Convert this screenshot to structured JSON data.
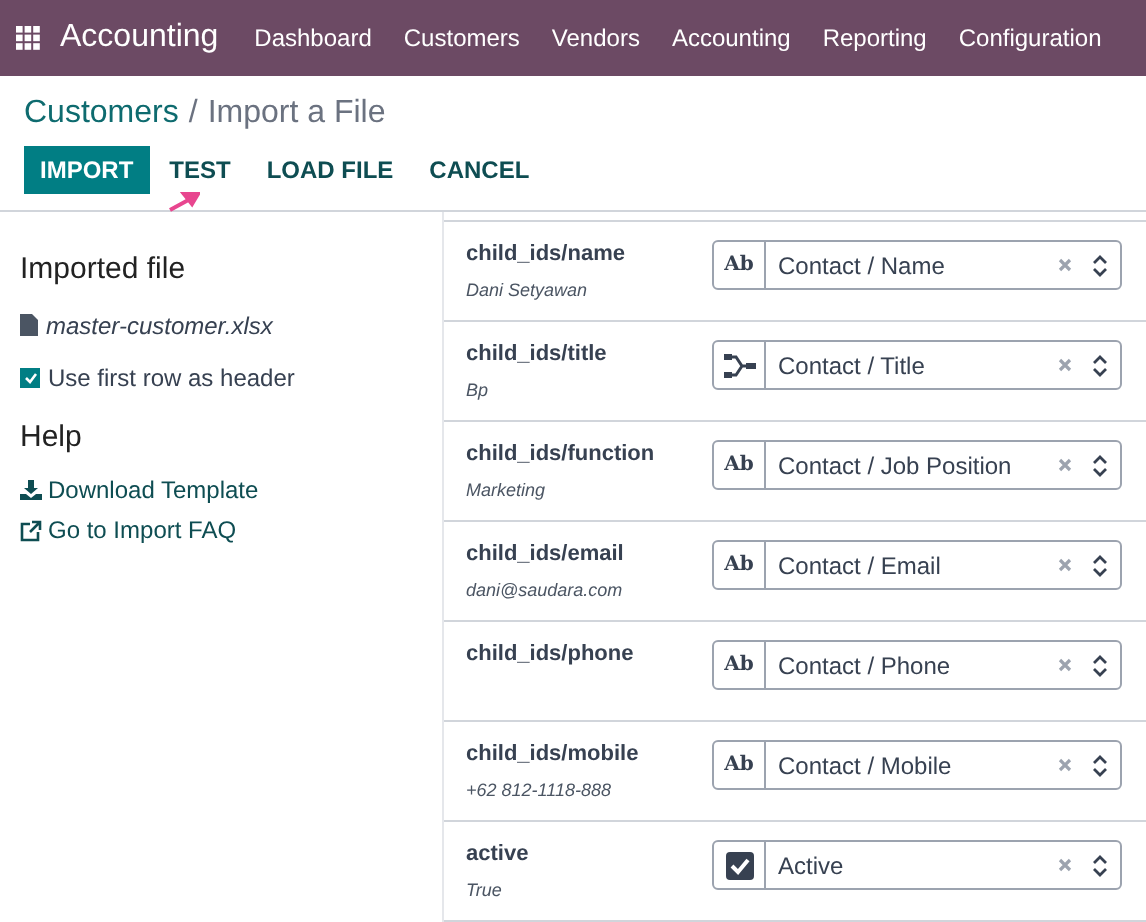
{
  "navbar": {
    "app": "Accounting",
    "menu": [
      "Dashboard",
      "Customers",
      "Vendors",
      "Accounting",
      "Reporting",
      "Configuration"
    ]
  },
  "breadcrumb": {
    "parent": "Customers",
    "separator": "/",
    "current": "Import a File"
  },
  "actions": [
    {
      "label": "IMPORT",
      "primary": true
    },
    {
      "label": "TEST",
      "primary": false
    },
    {
      "label": "LOAD FILE",
      "primary": false
    },
    {
      "label": "CANCEL",
      "primary": false
    }
  ],
  "sidebar": {
    "file_heading": "Imported file",
    "file_name": "master-customer.xlsx",
    "header_option": {
      "label": "Use first row as header",
      "checked": true
    },
    "help_heading": "Help",
    "links": [
      {
        "kind": "download",
        "label": "Download Template"
      },
      {
        "kind": "external",
        "label": "Go to Import FAQ"
      }
    ]
  },
  "mappings": [
    {
      "column": "child_ids/name",
      "sample": "Dani Setyawan",
      "kind": "text",
      "type_label": "Ab",
      "field": "Contact / Name"
    },
    {
      "column": "child_ids/title",
      "sample": "Bp",
      "kind": "relation",
      "field": "Contact / Title"
    },
    {
      "column": "child_ids/function",
      "sample": "Marketing",
      "kind": "text",
      "type_label": "Ab",
      "field": "Contact / Job Position"
    },
    {
      "column": "child_ids/email",
      "sample": "dani@saudara.com",
      "kind": "text",
      "type_label": "Ab",
      "field": "Contact / Email"
    },
    {
      "column": "child_ids/phone",
      "kind": "text",
      "type_label": "Ab",
      "field": "Contact / Phone"
    },
    {
      "column": "child_ids/mobile",
      "sample": "+62 812-1118-888",
      "kind": "text",
      "type_label": "Ab",
      "field": "Contact / Mobile"
    },
    {
      "column": "active",
      "sample": "True",
      "kind": "boolean",
      "field": "Active"
    }
  ]
}
